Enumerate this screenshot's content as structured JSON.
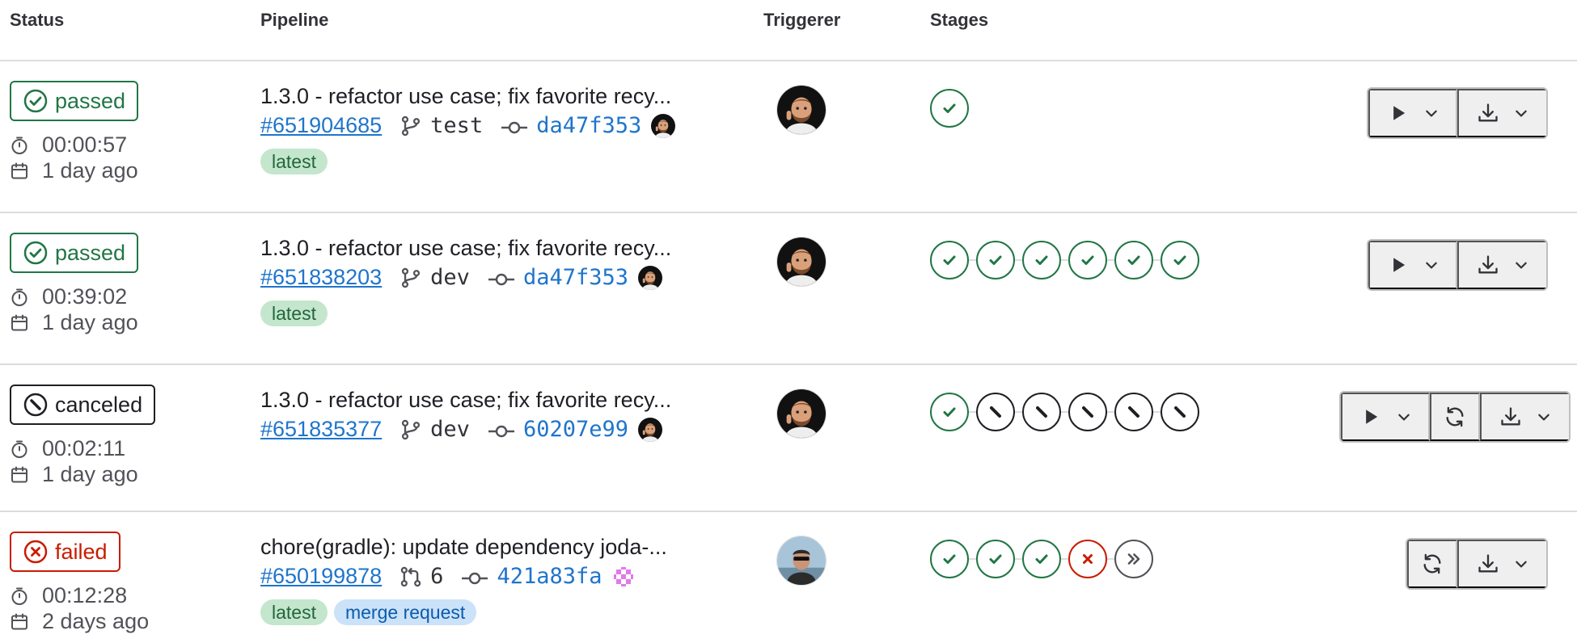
{
  "columns": {
    "status": "Status",
    "pipeline": "Pipeline",
    "triggerer": "Triggerer",
    "stages": "Stages"
  },
  "colors": {
    "success": "#217645",
    "failed": "#c91c00",
    "link": "#1f75cb",
    "border": "#dcdcde"
  },
  "rows": [
    {
      "status": "passed",
      "status_label": "passed",
      "duration": "00:00:57",
      "finished": "1 day ago",
      "title": "1.3.0 - refactor use case; fix favorite recy...",
      "id": "#651904685",
      "ref_type": "branch",
      "ref": "test",
      "sha": "da47f353",
      "tags": [
        "latest"
      ],
      "stages": [
        "success"
      ],
      "actions": [
        "play-dropdown",
        "download-dropdown"
      ]
    },
    {
      "status": "passed",
      "status_label": "passed",
      "duration": "00:39:02",
      "finished": "1 day ago",
      "title": "1.3.0 - refactor use case; fix favorite recy...",
      "id": "#651838203",
      "ref_type": "branch",
      "ref": "dev",
      "sha": "da47f353",
      "tags": [
        "latest"
      ],
      "stages": [
        "success",
        "success",
        "success",
        "success",
        "success",
        "success"
      ],
      "actions": [
        "play-dropdown",
        "download-dropdown"
      ]
    },
    {
      "status": "canceled",
      "status_label": "canceled",
      "duration": "00:02:11",
      "finished": "1 day ago",
      "title": "1.3.0 - refactor use case; fix favorite recy...",
      "id": "#651835377",
      "ref_type": "branch",
      "ref": "dev",
      "sha": "60207e99",
      "tags": [],
      "stages": [
        "success",
        "canceled",
        "canceled",
        "canceled",
        "canceled",
        "canceled"
      ],
      "actions": [
        "play-dropdown",
        "retry",
        "download-dropdown"
      ]
    },
    {
      "status": "failed",
      "status_label": "failed",
      "duration": "00:12:28",
      "finished": "2 days ago",
      "title": "chore(gradle): update dependency joda-...",
      "id": "#650199878",
      "ref_type": "merge-request",
      "ref": "6",
      "sha": "421a83fa",
      "tags": [
        "latest",
        "merge request"
      ],
      "stages": [
        "success",
        "success",
        "success",
        "failed",
        "skipped"
      ],
      "actions": [
        "retry",
        "download-dropdown"
      ]
    }
  ]
}
